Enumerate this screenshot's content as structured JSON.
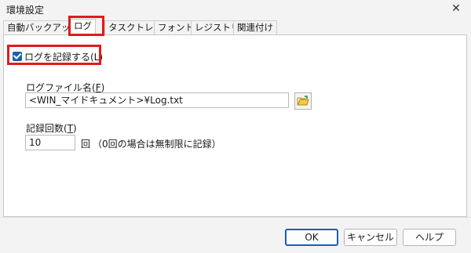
{
  "window": {
    "title": "環境設定",
    "close": "✕"
  },
  "tabs": [
    {
      "label": "自動バックアップ"
    },
    {
      "label": "ログ",
      "active": true
    },
    {
      "label": "タスクトレイ"
    },
    {
      "label": "フォント"
    },
    {
      "label": "レジストリ"
    },
    {
      "label": "関連付け"
    }
  ],
  "log": {
    "enable_checkbox": {
      "label": "ログを記録する(L)",
      "checked": true
    },
    "filename": {
      "label_prefix": "ログファイル名(",
      "label_key": "F",
      "label_suffix": ")",
      "value": "<WIN_マイドキュメント>¥Log.txt"
    },
    "count": {
      "label_prefix": "記録回数(",
      "label_key": "T",
      "label_suffix": ")",
      "value": "10",
      "unit": "回",
      "note": "（0回の場合は無制限に記録）"
    }
  },
  "buttons": {
    "ok": "OK",
    "cancel": "キャンセル",
    "help": "ヘルプ"
  },
  "colors": {
    "highlight": "#e01b1b",
    "accent": "#1a5fb4"
  }
}
